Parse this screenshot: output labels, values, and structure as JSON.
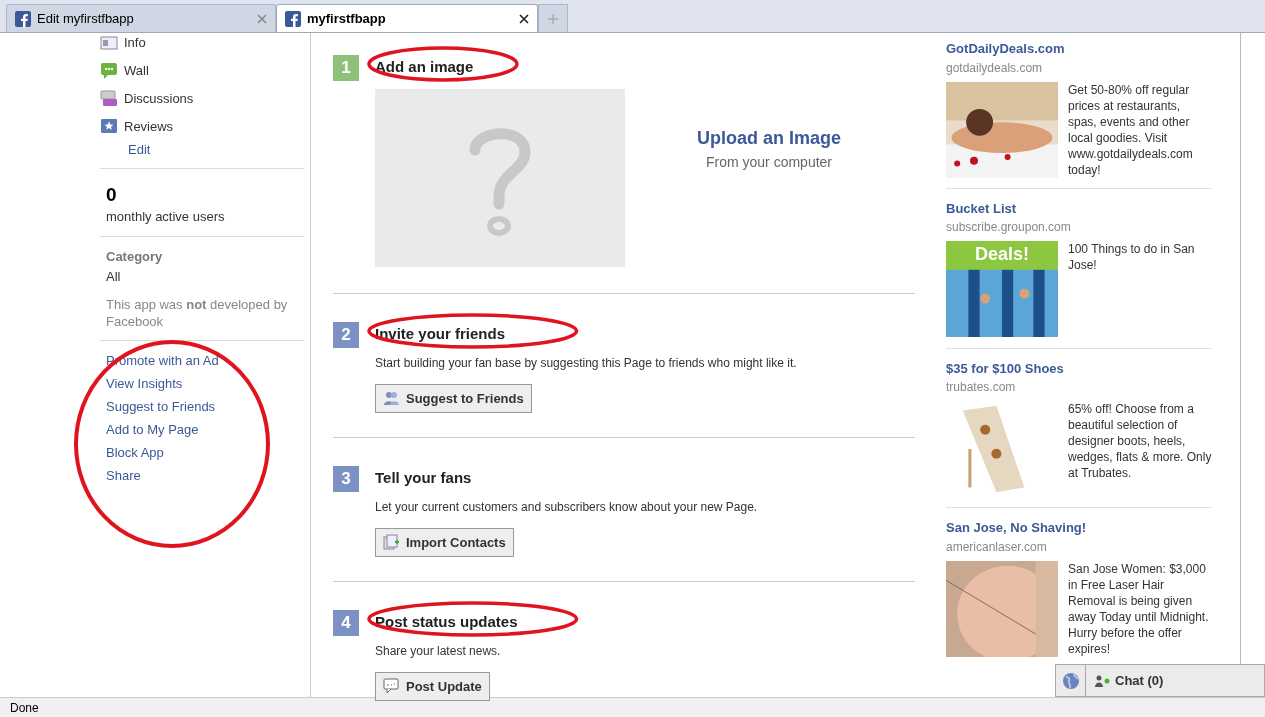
{
  "tabs": [
    {
      "label": "Edit myfirstfbapp",
      "selected": false
    },
    {
      "label": "myfirstfbapp",
      "selected": true
    }
  ],
  "sidebar": {
    "nav": [
      {
        "label": "Info"
      },
      {
        "label": "Wall"
      },
      {
        "label": "Discussions"
      },
      {
        "label": "Reviews"
      }
    ],
    "edit_link": "Edit",
    "users_count": "0",
    "users_label": "monthly active users",
    "category_label": "Category",
    "category_value": "All",
    "developer_note": "This app was **not** developed by Facebook",
    "links": [
      "Promote with an Ad",
      "View Insights",
      "Suggest to Friends",
      "Add to My Page",
      "Block App",
      "Share"
    ],
    "links_circled": true
  },
  "steps": [
    {
      "kind": "upload",
      "number": "1",
      "title": "Add an image",
      "circled": true,
      "upload_title": "Upload an Image",
      "upload_sub": "From your computer"
    },
    {
      "kind": "action",
      "number": "2",
      "title": "Invite your friends",
      "circled": true,
      "text": "Start building your fan base by suggesting this Page to friends who might like it.",
      "button": "Suggest to Friends"
    },
    {
      "kind": "action",
      "number": "3",
      "title": "Tell your fans",
      "circled": false,
      "text": "Let your current customers and subscribers know about your new Page.",
      "button": "Import Contacts"
    },
    {
      "kind": "action",
      "number": "4",
      "title": "Post status updates",
      "circled": true,
      "text": "Share your latest news.",
      "button": "Post Update"
    }
  ],
  "ads": [
    {
      "title": "GotDailyDeals.com",
      "domain": "gotdailydeals.com",
      "text": "Get 50-80% off regular prices at restaurants, spas, events and other local goodies. Visit www.gotdailydeals.com today!"
    },
    {
      "title": "Bucket List",
      "domain": "subscribe.groupon.com",
      "text": "100 Things to do in San Jose!",
      "pic_caption": "Deals!"
    },
    {
      "title": "$35 for $100 Shoes",
      "domain": "trubates.com",
      "text": "65% off! Choose from a beautiful selection of designer boots, heels, wedges, flats & more. Only at Trubates."
    },
    {
      "title": "San Jose, No Shaving!",
      "domain": "americanlaser.com",
      "text": "San Jose Women: $3,000 in Free Laser Hair Removal is being given away Today until Midnight. Hurry before the offer expires!"
    }
  ],
  "chat": {
    "label": "Chat",
    "count": "(0)"
  },
  "status_bar": "Done"
}
